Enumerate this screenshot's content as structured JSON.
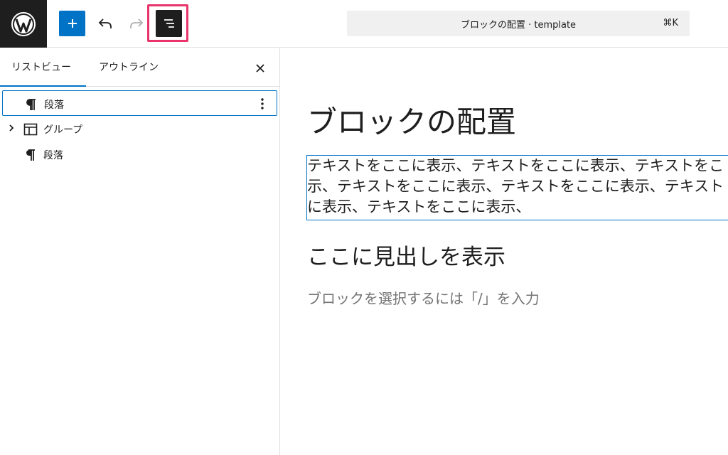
{
  "toolbar": {
    "logo": "wordpress-logo",
    "command_title": "ブロックの配置 · template",
    "command_shortcut": "⌘K"
  },
  "sidebar": {
    "tabs": [
      {
        "label": "リストビュー",
        "active": true
      },
      {
        "label": "アウトライン",
        "active": false
      }
    ],
    "items": [
      {
        "label": "段落",
        "icon": "paragraph-icon",
        "selected": true,
        "expandable": false
      },
      {
        "label": "グループ",
        "icon": "group-icon",
        "selected": false,
        "expandable": true
      },
      {
        "label": "段落",
        "icon": "paragraph-icon",
        "selected": false,
        "expandable": false
      }
    ]
  },
  "canvas": {
    "title": "ブロックの配置",
    "paragraph_lines": [
      "テキストをここに表示、テキストをここに表示、テキストをこ",
      "示、テキストをここに表示、テキストをここに表示、テキスト",
      "に表示、テキストをここに表示、"
    ],
    "heading": "ここに見出しを表示",
    "placeholder": "ブロックを選択するには「/」を入力"
  },
  "colors": {
    "accent": "#0073c6",
    "highlight": "#e8336b",
    "dark": "#1e1e1e"
  }
}
